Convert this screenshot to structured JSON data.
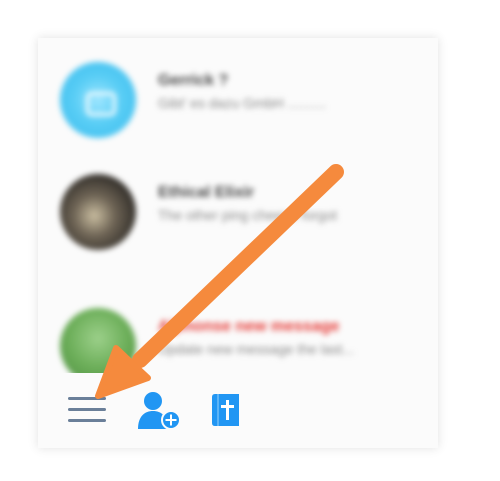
{
  "chats": [
    {
      "name": "Gerrick ?",
      "preview": "Gibt' es dazu GmbH ..........",
      "avatar": "blue-chat-icon",
      "unread": false
    },
    {
      "name": "Ethical Elixir",
      "preview": "The other ping cheese forgot",
      "avatar": "dark-photo",
      "unread": false
    },
    {
      "name": "Alphonse new message",
      "preview": "Update new message the last...",
      "avatar": "green-tree-photo",
      "unread": true
    }
  ],
  "toolbar": {
    "menu": "hamburger-menu-icon",
    "add_contact": "add-contact-icon",
    "note": "book-icon"
  },
  "colors": {
    "accent": "#2196f3",
    "arrow": "#f58a3d",
    "menu_icon": "#6a7f99",
    "unread_name": "#e53935"
  }
}
